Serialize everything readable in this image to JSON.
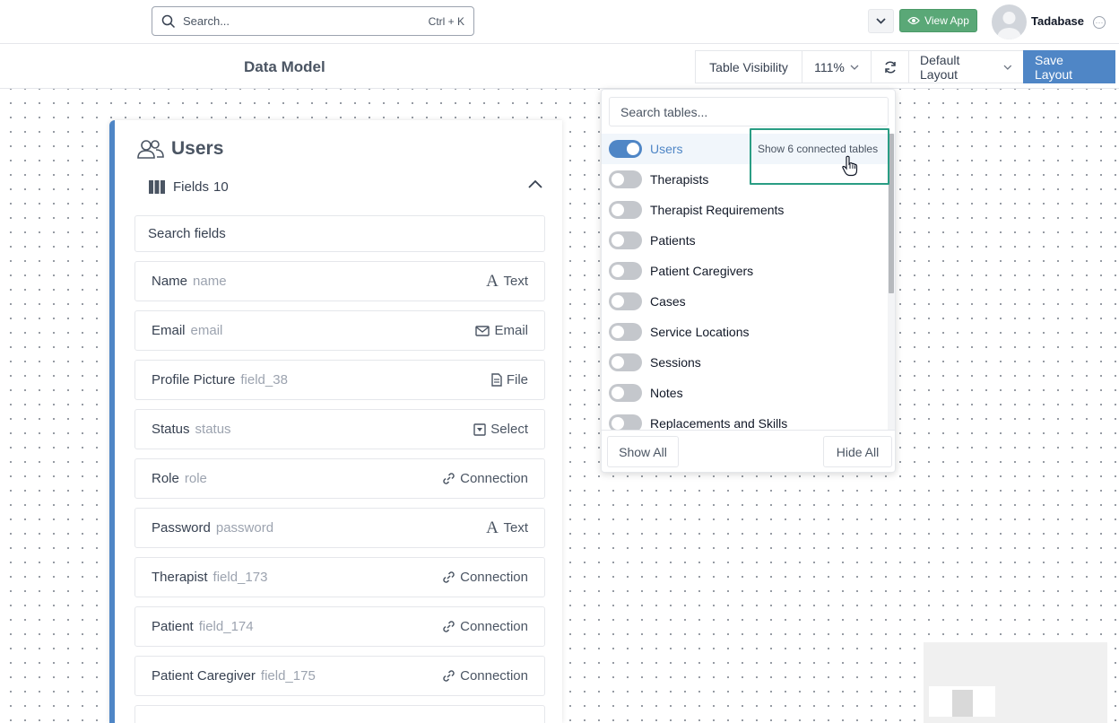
{
  "topbar": {
    "search_placeholder": "Search...",
    "search_shortcut": "Ctrl + K",
    "view_app_label": "View App",
    "username": "Tadabase"
  },
  "subbar": {
    "page_title": "Data Model",
    "table_visibility_label": "Table Visibility",
    "zoom_label": "111%",
    "layout_label": "Default Layout",
    "save_label": "Save Layout"
  },
  "table_card": {
    "title": "Users",
    "fields_label": "Fields",
    "fields_count": "10",
    "search_placeholder": "Search fields",
    "fields": [
      {
        "name": "Name",
        "key": "name",
        "type": "Text",
        "type_icon": "text-icon"
      },
      {
        "name": "Email",
        "key": "email",
        "type": "Email",
        "type_icon": "envelope-icon"
      },
      {
        "name": "Profile Picture",
        "key": "field_38",
        "type": "File",
        "type_icon": "file-icon"
      },
      {
        "name": "Status",
        "key": "status",
        "type": "Select",
        "type_icon": "select-icon"
      },
      {
        "name": "Role",
        "key": "role",
        "type": "Connection",
        "type_icon": "link-icon"
      },
      {
        "name": "Password",
        "key": "password",
        "type": "Text",
        "type_icon": "text-icon"
      },
      {
        "name": "Therapist",
        "key": "field_173",
        "type": "Connection",
        "type_icon": "link-icon"
      },
      {
        "name": "Patient",
        "key": "field_174",
        "type": "Connection",
        "type_icon": "link-icon"
      },
      {
        "name": "Patient Caregiver",
        "key": "field_175",
        "type": "Connection",
        "type_icon": "link-icon"
      }
    ]
  },
  "visibility_panel": {
    "search_placeholder": "Search tables...",
    "connected_tables_label": "Show 6 connected tables",
    "tables": [
      {
        "name": "Users",
        "enabled": true
      },
      {
        "name": "Therapists",
        "enabled": false
      },
      {
        "name": "Therapist Requirements",
        "enabled": false
      },
      {
        "name": "Patients",
        "enabled": false
      },
      {
        "name": "Patient Caregivers",
        "enabled": false
      },
      {
        "name": "Cases",
        "enabled": false
      },
      {
        "name": "Service Locations",
        "enabled": false
      },
      {
        "name": "Sessions",
        "enabled": false
      },
      {
        "name": "Notes",
        "enabled": false
      },
      {
        "name": "Replacements and Skills",
        "enabled": false
      }
    ],
    "show_all_label": "Show All",
    "hide_all_label": "Hide All"
  },
  "colors": {
    "accent": "#4f86c6",
    "view_app": "#5aa877",
    "highlight": "#2a9d84"
  }
}
